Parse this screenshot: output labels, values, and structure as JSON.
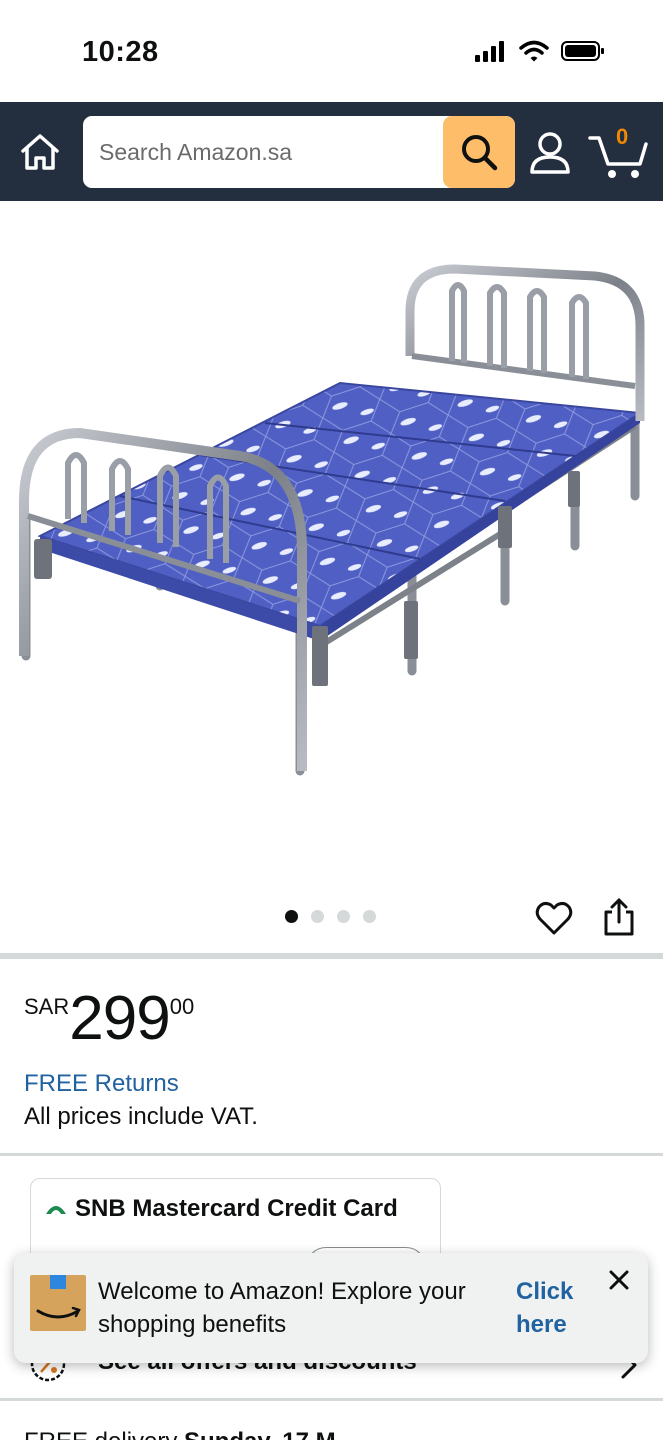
{
  "status_bar": {
    "time": "10:28"
  },
  "header": {
    "search": {
      "placeholder": "Search Amazon.sa"
    },
    "cart": {
      "count": "0"
    }
  },
  "carousel": {
    "total": 4,
    "active": 1
  },
  "price": {
    "currency": "SAR",
    "whole": "299",
    "fraction": "00"
  },
  "returns_label": "FREE Returns",
  "vat_note": "All prices include VAT.",
  "offer_card": {
    "title": "SNB Mastercard Credit Card"
  },
  "offers_row": {
    "label": "See all offers and discounts"
  },
  "delivery": {
    "prefix": "FREE delivery",
    "date": "Sunday, 17 M"
  },
  "toast": {
    "message": "Welcome to Amazon! Explore your shopping benefits",
    "link": "Click here"
  },
  "colors": {
    "nav_bg": "#232f3e",
    "search_button": "#febd69",
    "link": "#2162a1",
    "cart_count": "#f08804"
  },
  "icons": [
    "home-icon",
    "search-icon",
    "account-icon",
    "cart-icon",
    "heart-icon",
    "share-icon",
    "percent-icon",
    "chevron-right-icon",
    "close-icon"
  ]
}
